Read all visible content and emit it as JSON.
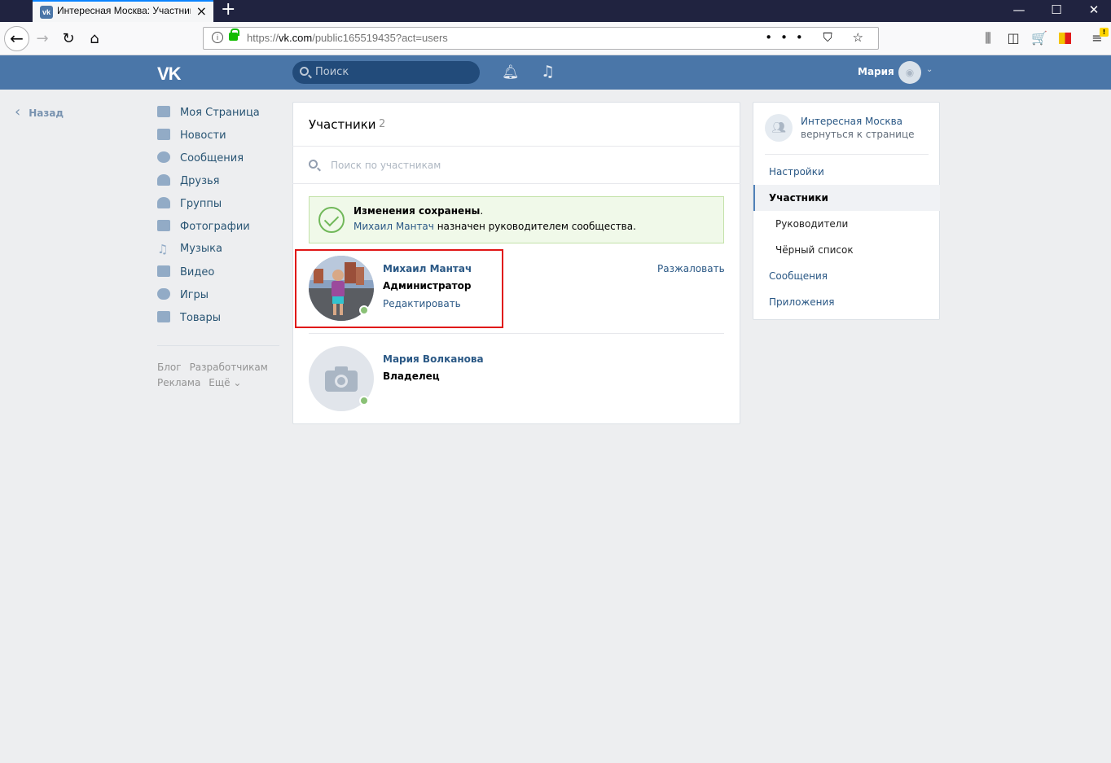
{
  "browser": {
    "tab_title": "Интересная Москва: Участники",
    "new_tab": "+",
    "url_prefix": "https://",
    "url_host": "vk.com",
    "url_path": "/public165519435?act=users",
    "url_actions": "••• ⛉ ☆",
    "win_min": "—",
    "win_max": "☐",
    "win_close": "✕"
  },
  "header": {
    "logo": "VK",
    "search_placeholder": "Поиск",
    "user_name": "Мария"
  },
  "left": {
    "back_label": "Назад",
    "nav": [
      {
        "label": "Моя Страница",
        "icon": "home-icon"
      },
      {
        "label": "Новости",
        "icon": "news-icon"
      },
      {
        "label": "Сообщения",
        "icon": "messages-icon"
      },
      {
        "label": "Друзья",
        "icon": "friends-icon"
      },
      {
        "label": "Группы",
        "icon": "groups-icon"
      },
      {
        "label": "Фотографии",
        "icon": "photos-icon"
      },
      {
        "label": "Музыка",
        "icon": "music-icon"
      },
      {
        "label": "Видео",
        "icon": "video-icon"
      },
      {
        "label": "Игры",
        "icon": "games-icon"
      },
      {
        "label": "Товары",
        "icon": "goods-icon"
      }
    ],
    "footer": [
      "Блог",
      "Разработчикам",
      "Реклама",
      "Ещё ⌄"
    ]
  },
  "main": {
    "title": "Участники",
    "count": "2",
    "search_placeholder": "Поиск по участникам",
    "notice_title": "Изменения сохранены",
    "notice_title_dot": ".",
    "notice_user": "Михаил Мантач",
    "notice_text": " назначен руководителем сообщества.",
    "members": [
      {
        "name": "Михаил Мантач",
        "role": "Администратор",
        "edit": "Редактировать",
        "demote": "Разжаловать"
      },
      {
        "name": "Мария Волканова",
        "role": "Владелец"
      }
    ]
  },
  "right": {
    "group_name": "Интересная Москва",
    "group_back": "вернуться к странице",
    "menu": [
      {
        "label": "Настройки"
      },
      {
        "label": "Участники"
      },
      {
        "label": "Руководители"
      },
      {
        "label": "Чёрный список"
      },
      {
        "label": "Сообщения"
      },
      {
        "label": "Приложения"
      }
    ]
  },
  "colors": {
    "vk_blue": "#4a76a8",
    "link": "#2a5885",
    "highlight_box": "#e01616",
    "online": "#8ac176"
  }
}
